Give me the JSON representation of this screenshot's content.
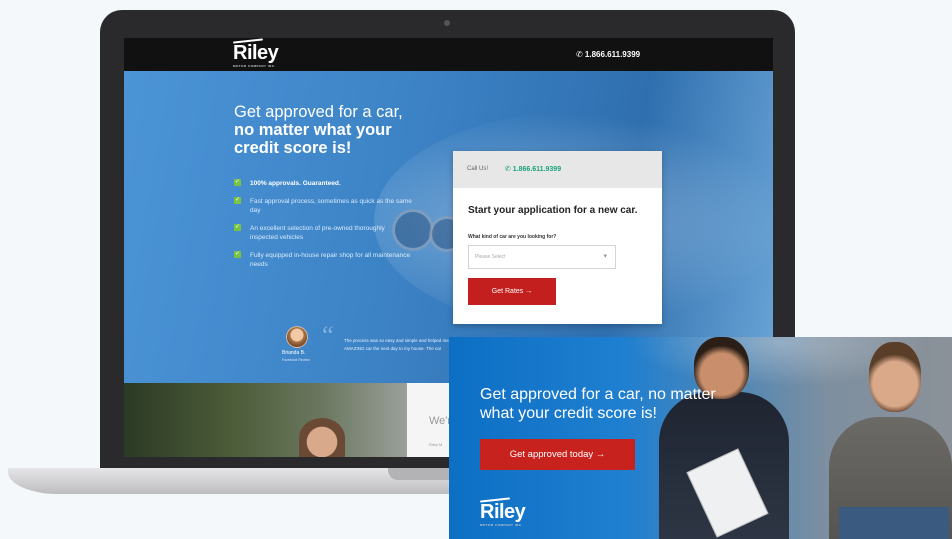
{
  "site": {
    "logo": {
      "brand": "Riley",
      "tagline": "MOTOR COMPANY INC."
    },
    "header_phone": "✆ 1.866.611.9399"
  },
  "hero": {
    "title_line1": "Get approved for a car,",
    "title_bold": "no matter what your credit score is!",
    "features": [
      "100% approvals. Guaranteed.",
      "Fast approval process, sometimes as quick as the same day",
      "An excellent selection of pre-owned thoroughly inspected vehicles",
      "Fully equipped in-house repair shop for all maintenance needs"
    ]
  },
  "form": {
    "call_label": "Call Us!",
    "call_number": "✆ 1.866.611.9399",
    "title": "Start your application for a new car.",
    "question": "What kind of car are you looking for?",
    "select_placeholder": "Please Select",
    "submit": "Get Rates →"
  },
  "testimonial": {
    "name": "Brianda B.",
    "source": "Facebook Review",
    "quote": "The process was so easy and simple and helped me get an AMAZING car the next day to my house. The car"
  },
  "lower": {
    "heading": "We're",
    "sub": "Riley M"
  },
  "ad": {
    "title": "Get approved for a car, no matter what your credit score is!",
    "button": "Get approved today →",
    "logo_brand": "Riley",
    "logo_tagline": "MOTOR COMPANY INC."
  },
  "colors": {
    "accent_red": "#c8221f",
    "check_green": "#7bc443",
    "phone_green": "#1aa37a"
  }
}
